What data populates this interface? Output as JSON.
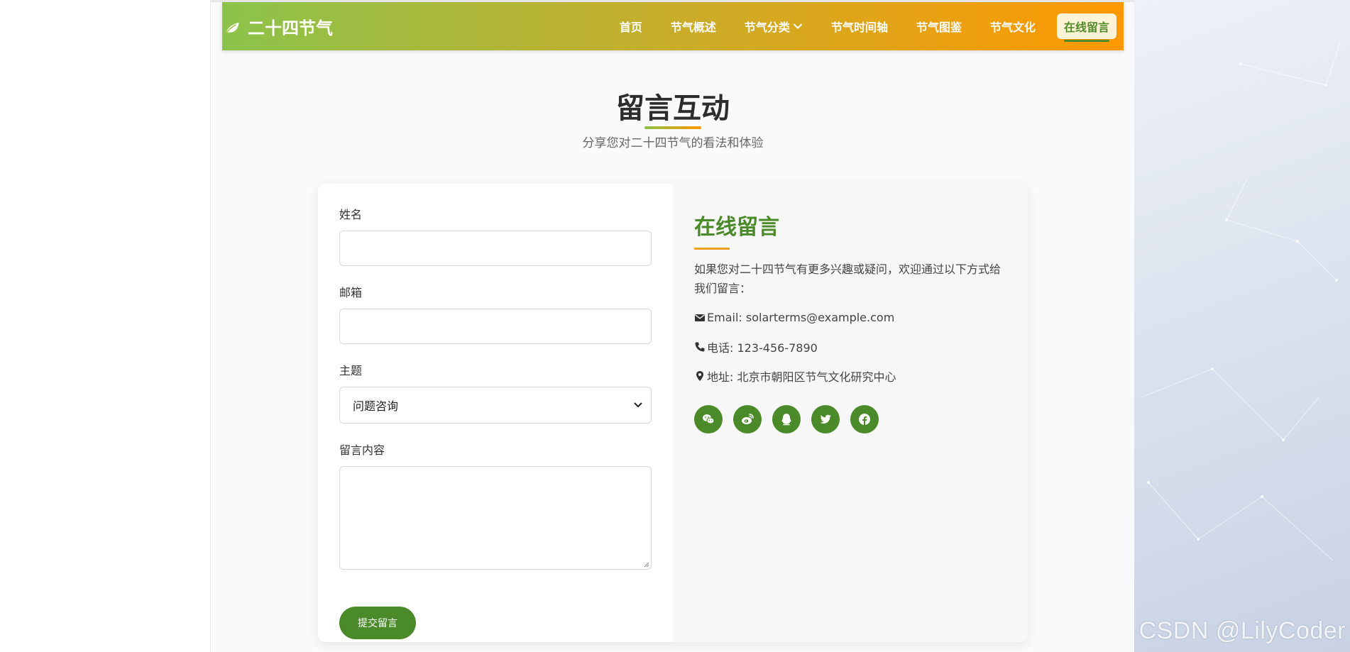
{
  "brand": {
    "title": "二十四节气"
  },
  "nav": {
    "items": [
      {
        "label": "首页"
      },
      {
        "label": "节气概述"
      },
      {
        "label": "节气分类"
      },
      {
        "label": "节气时间轴"
      },
      {
        "label": "节气图鉴"
      },
      {
        "label": "节气文化"
      },
      {
        "label": "在线留言"
      }
    ],
    "active_index": 6
  },
  "section": {
    "title": "留言互动",
    "subtitle": "分享您对二十四节气的看法和体验"
  },
  "form": {
    "name_label": "姓名",
    "name_value": "",
    "email_label": "邮箱",
    "email_value": "",
    "subject_label": "主题",
    "subject_selected": "问题咨询",
    "message_label": "留言内容",
    "message_value": "",
    "submit_label": "提交留言"
  },
  "info": {
    "title": "在线留言",
    "description": "如果您对二十四节气有更多兴趣或疑问，欢迎通过以下方式给我们留言：",
    "email": "Email: solarterms@example.com",
    "phone": "电话: 123-456-7890",
    "address": "地址: 北京市朝阳区节气文化研究中心",
    "social_icons": [
      "wechat-icon",
      "weibo-icon",
      "qq-icon",
      "twitter-icon",
      "facebook-icon"
    ]
  },
  "watermark": "CSDN @LilyCoder",
  "colors": {
    "primary_green": "#4a8a28",
    "gradient_start": "#8bc34a",
    "gradient_end": "#ff9800"
  }
}
